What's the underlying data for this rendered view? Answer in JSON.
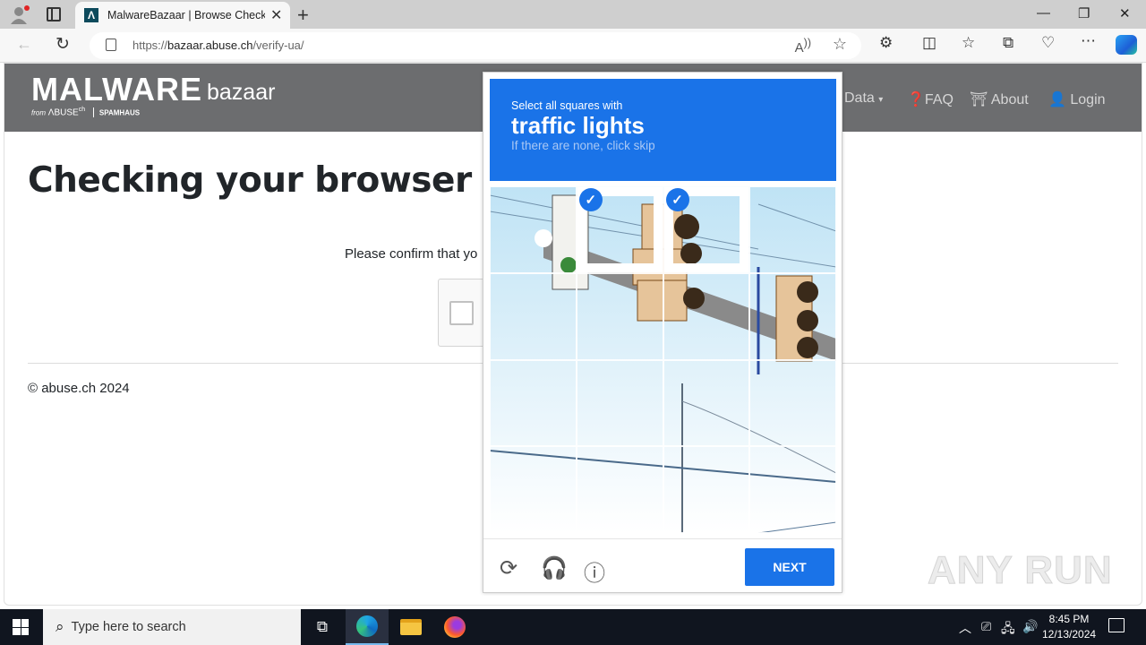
{
  "browser": {
    "tab_title": "MalwareBazaar | Browse Checkin",
    "tab_favicon": "Λ",
    "url_host": "bazaar.abuse.ch",
    "url_scheme": "https://",
    "url_path": "/verify-ua/",
    "icons": [
      "profile-icon",
      "tab-actions-icon",
      "back-icon",
      "reload-icon",
      "lock-icon",
      "read-aloud-icon",
      "favorite-star-icon",
      "extensions-icon",
      "split-screen-icon",
      "favorites-icon",
      "collections-icon",
      "browser-essentials-icon",
      "more-icon",
      "copilot-icon"
    ],
    "window_controls": {
      "minimize": "—",
      "restore": "❐",
      "close": "✕"
    }
  },
  "site": {
    "logo_main": "MALWARE",
    "logo_sub": "bazaar",
    "logo_from": "from",
    "logo_abuse": "ΛBUSE",
    "logo_ch": "ch",
    "logo_spamhaus": "SPAMHAUS",
    "nav": [
      {
        "label": "Data",
        "icon": "caret-down-icon"
      },
      {
        "label": "FAQ",
        "icon": "question-circle-icon"
      },
      {
        "label": "About",
        "icon": "building-icon"
      },
      {
        "label": "Login",
        "icon": "user-icon"
      }
    ],
    "heading": "Checking your browser",
    "confirm_text": "Please confirm that yo",
    "footer": "© abuse.ch 2024"
  },
  "captcha": {
    "instruction_line1": "Select all squares with",
    "target": "traffic lights",
    "instruction_line3": "If there are none, click skip",
    "selected_tiles": [
      1,
      2
    ],
    "grid_size": 4,
    "next_label": "NEXT",
    "footer_icons": [
      "reload-challenge-icon",
      "audio-challenge-icon",
      "info-icon"
    ]
  },
  "watermark": "ANY RUN",
  "taskbar": {
    "search_placeholder": "Type here to search",
    "apps": [
      "task-view",
      "edge",
      "file-explorer",
      "firefox"
    ],
    "time": "8:45 PM",
    "date": "12/13/2024"
  }
}
